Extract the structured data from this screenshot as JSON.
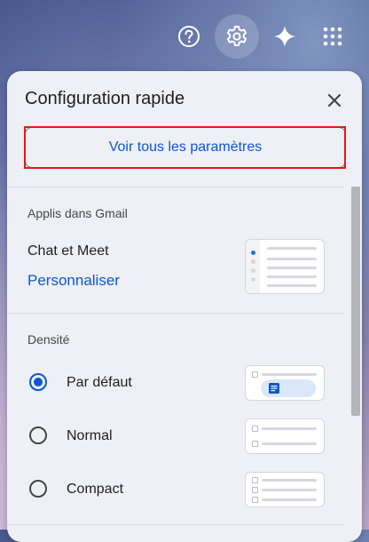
{
  "topbar": {
    "icons": [
      "help-icon",
      "settings-icon",
      "gemini-sparkle-icon",
      "apps-grid-icon"
    ]
  },
  "quick_settings": {
    "title": "Configuration rapide",
    "see_all_label": "Voir tous les paramètres",
    "apps_section": {
      "heading": "Applis dans Gmail",
      "item_label": "Chat et Meet",
      "customize_label": "Personnaliser"
    },
    "density_section": {
      "heading": "Densité",
      "options": [
        {
          "label": "Par défaut",
          "selected": true
        },
        {
          "label": "Normal",
          "selected": false
        },
        {
          "label": "Compact",
          "selected": false
        }
      ]
    }
  },
  "colors": {
    "accent": "#0b57d0",
    "highlight_border": "#e01b1b",
    "panel_bg": "#eef0f5"
  }
}
